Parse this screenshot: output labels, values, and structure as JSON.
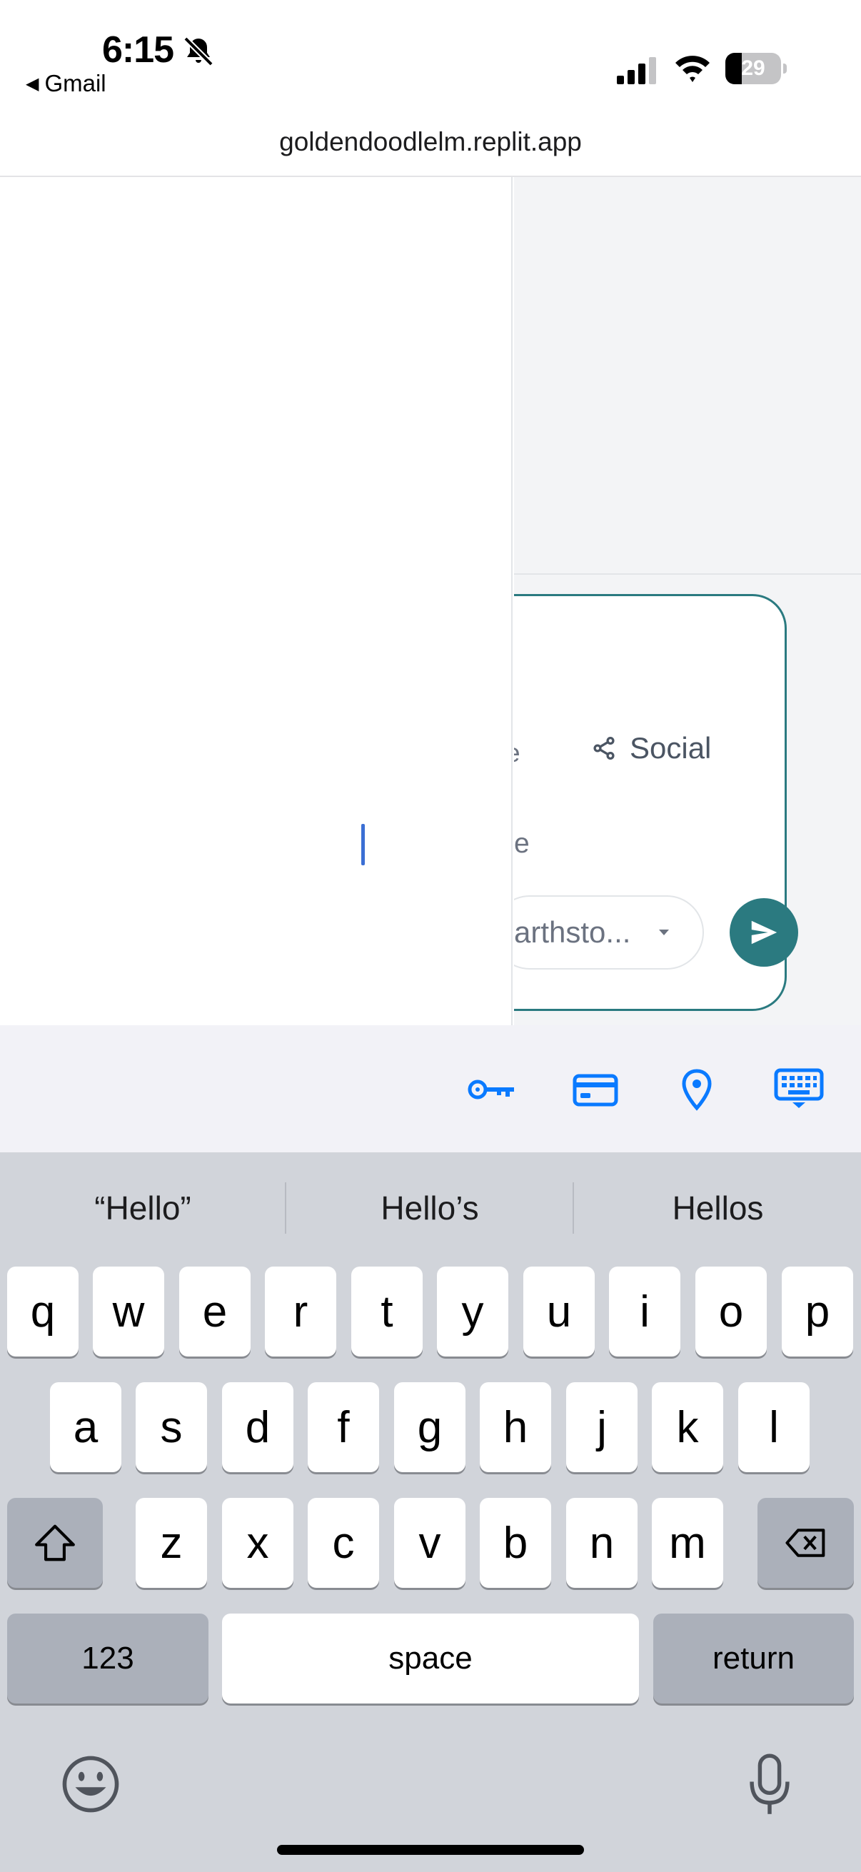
{
  "status_bar": {
    "time": "6:15",
    "back_app": "Gmail",
    "battery": "29",
    "icons": [
      "bell-slash-icon",
      "cellular-signal-icon",
      "wifi-icon",
      "battery-icon"
    ]
  },
  "browser": {
    "url": "goldendoodlelm.replit.app"
  },
  "composer": {
    "partial_label_1": "e",
    "social_label": "Social",
    "partial_label_2": "e",
    "select_value": "arthsto...",
    "send_icon": "send-icon",
    "accent_color": "#2b7a80"
  },
  "accessory_bar": {
    "icons": [
      "key-icon",
      "credit-card-icon",
      "location-pin-icon",
      "keyboard-dismiss-icon"
    ],
    "accent_color": "#0a7aff"
  },
  "keyboard": {
    "suggestions": [
      "“Hello”",
      "Hello’s",
      "Hellos"
    ],
    "row1": [
      "q",
      "w",
      "e",
      "r",
      "t",
      "y",
      "u",
      "i",
      "o",
      "p"
    ],
    "row2": [
      "a",
      "s",
      "d",
      "f",
      "g",
      "h",
      "j",
      "k",
      "l"
    ],
    "row3": [
      "z",
      "x",
      "c",
      "v",
      "b",
      "n",
      "m"
    ],
    "numbers_key": "123",
    "space_key": "space",
    "return_key": "return"
  }
}
